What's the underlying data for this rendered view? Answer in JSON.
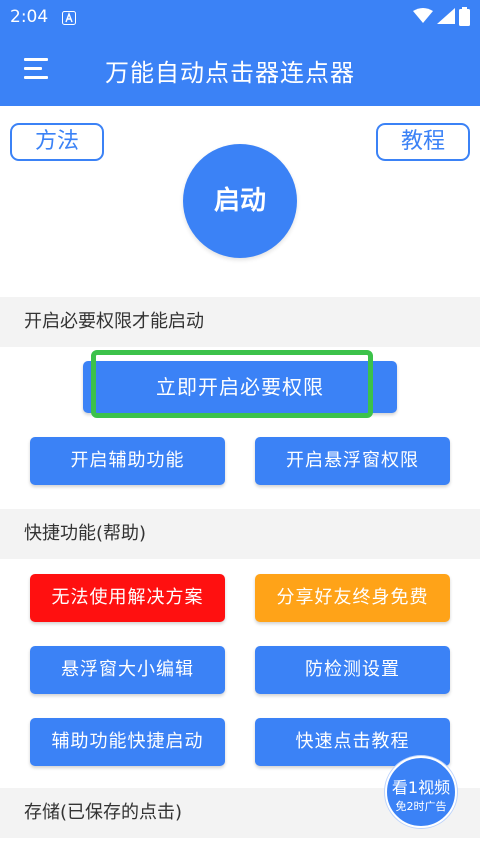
{
  "status": {
    "time": "2:04",
    "app_icon": "text-app-icon",
    "wifi_icon": "wifi-icon",
    "signal_icon": "signal-icon",
    "battery_icon": "battery-icon"
  },
  "appbar": {
    "menu_icon": "hamburger-menu-icon",
    "title": "万能自动点击器连点器"
  },
  "top_buttons": {
    "method": "方法",
    "tutorial": "教程"
  },
  "start_button": "启动",
  "permissions": {
    "section_title": "开启必要权限才能启动",
    "grant_button": "立即开启必要权限",
    "accessibility_button": "开启辅助功能",
    "overlay_button": "开启悬浮窗权限"
  },
  "quick": {
    "section_title": "快捷功能(帮助)",
    "items": [
      {
        "label": "无法使用解决方案",
        "color": "#ff1010"
      },
      {
        "label": "分享好友终身免费",
        "color": "#ffa318"
      },
      {
        "label": "悬浮窗大小编辑",
        "color": "#3b82f6"
      },
      {
        "label": "防检测设置",
        "color": "#3b82f6"
      },
      {
        "label": "辅助功能快捷启动",
        "color": "#3b82f6"
      },
      {
        "label": "快速点击教程",
        "color": "#3b82f6"
      }
    ]
  },
  "storage": {
    "section_title": "存储(已保存的点击)"
  },
  "video_ad": {
    "main": "看1视频",
    "sub": "免2时广告"
  },
  "colors": {
    "primary": "#3b82f6",
    "highlight": "#3cc24a"
  }
}
